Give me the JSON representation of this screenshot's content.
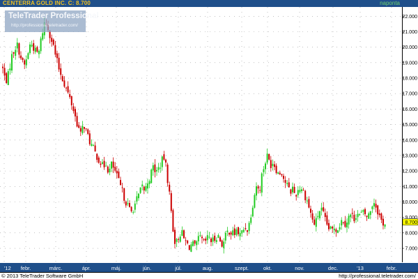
{
  "header": {
    "symbol": "CENTERRA GOLD INC.",
    "close_text": "C: 8.700",
    "period": "naponta"
  },
  "logo": {
    "title": "TeleTrader Professional",
    "url": "http://professional.teletrader.com/"
  },
  "footer": {
    "copyright": "© 2013 TeleTrader Software GmbH",
    "url": "http://professional.teletrader.com/"
  },
  "colors": {
    "up": "#22cc22",
    "down": "#cc0000",
    "header_bg": "#1f4f8a",
    "symbol_text": "#f0c020",
    "last_price_marker": "#ffff00"
  },
  "chart_data": {
    "type": "candlestick",
    "y_ticks": [
      "7.000",
      "8.000",
      "9.000",
      "10.000",
      "11.000",
      "12.000",
      "13.000",
      "14.000",
      "15.000",
      "16.000",
      "17.000",
      "18.000",
      "19.000",
      "20.000",
      "21.000",
      "22.000"
    ],
    "ylim": [
      6.1,
      22.6
    ],
    "x_labels": [
      "'12",
      "febr.",
      "márc.",
      "ápr.",
      "máj.",
      "jún.",
      "júl.",
      "aug.",
      "szept.",
      "okt.",
      "nov.",
      "dec.",
      "'13",
      "febr."
    ],
    "last_price": 8.7,
    "last_price_label": "8.700",
    "grid": true,
    "daily_close_path": [
      [
        0,
        19.4
      ],
      [
        4,
        18.6
      ],
      [
        8,
        17.8
      ],
      [
        12,
        18.2
      ],
      [
        16,
        19.3
      ],
      [
        20,
        19.8
      ],
      [
        24,
        20.2
      ],
      [
        28,
        19.7
      ],
      [
        32,
        19.0
      ],
      [
        36,
        18.8
      ],
      [
        40,
        19.6
      ],
      [
        44,
        20.3
      ],
      [
        48,
        20.0
      ],
      [
        52,
        19.6
      ],
      [
        56,
        19.7
      ],
      [
        60,
        20.8
      ],
      [
        64,
        21.6
      ],
      [
        68,
        21.4
      ],
      [
        72,
        20.8
      ],
      [
        76,
        20.2
      ],
      [
        80,
        19.4
      ],
      [
        84,
        18.7
      ],
      [
        88,
        18.2
      ],
      [
        92,
        17.7
      ],
      [
        96,
        17.2
      ],
      [
        100,
        16.7
      ],
      [
        104,
        16.2
      ],
      [
        108,
        15.5
      ],
      [
        112,
        14.9
      ],
      [
        116,
        14.3
      ],
      [
        120,
        15.1
      ],
      [
        124,
        14.5
      ],
      [
        128,
        14.0
      ],
      [
        132,
        13.6
      ],
      [
        136,
        13.2
      ],
      [
        140,
        12.9
      ],
      [
        144,
        12.6
      ],
      [
        148,
        12.2
      ],
      [
        152,
        12.6
      ],
      [
        156,
        11.9
      ],
      [
        160,
        12.4
      ],
      [
        164,
        12.1
      ],
      [
        168,
        11.6
      ],
      [
        172,
        11.1
      ],
      [
        176,
        10.6
      ],
      [
        180,
        10.1
      ],
      [
        184,
        9.7
      ],
      [
        188,
        9.3
      ],
      [
        192,
        9.7
      ],
      [
        196,
        10.1
      ],
      [
        200,
        10.5
      ],
      [
        204,
        11.0
      ],
      [
        208,
        10.7
      ],
      [
        212,
        11.3
      ],
      [
        216,
        11.7
      ],
      [
        220,
        12.3
      ],
      [
        224,
        11.9
      ],
      [
        228,
        12.2
      ],
      [
        232,
        12.6
      ],
      [
        236,
        12.9
      ],
      [
        240,
        11.7
      ],
      [
        244,
        10.2
      ],
      [
        248,
        8.4
      ],
      [
        252,
        7.2
      ],
      [
        256,
        7.7
      ],
      [
        260,
        8.1
      ],
      [
        264,
        7.6
      ],
      [
        268,
        7.3
      ],
      [
        272,
        7.1
      ],
      [
        276,
        7.3
      ],
      [
        280,
        7.0
      ],
      [
        284,
        7.5
      ],
      [
        288,
        7.7
      ],
      [
        292,
        7.3
      ],
      [
        296,
        7.5
      ],
      [
        300,
        7.8
      ],
      [
        304,
        7.4
      ],
      [
        308,
        7.6
      ],
      [
        312,
        7.9
      ],
      [
        316,
        7.5
      ],
      [
        320,
        7.2
      ],
      [
        324,
        7.8
      ],
      [
        328,
        8.2
      ],
      [
        332,
        8.0
      ],
      [
        336,
        7.9
      ],
      [
        340,
        8.2
      ],
      [
        344,
        7.8
      ],
      [
        348,
        8.1
      ],
      [
        352,
        8.4
      ],
      [
        356,
        8.2
      ],
      [
        360,
        9.2
      ],
      [
        364,
        10.2
      ],
      [
        368,
        11.1
      ],
      [
        372,
        10.6
      ],
      [
        376,
        11.8
      ],
      [
        380,
        12.5
      ],
      [
        384,
        13.0
      ],
      [
        388,
        12.4
      ],
      [
        392,
        12.6
      ],
      [
        396,
        12.2
      ],
      [
        400,
        11.8
      ],
      [
        404,
        12.0
      ],
      [
        408,
        11.4
      ],
      [
        412,
        11.1
      ],
      [
        416,
        10.6
      ],
      [
        420,
        10.9
      ],
      [
        424,
        10.4
      ],
      [
        428,
        10.8
      ],
      [
        432,
        11.0
      ],
      [
        436,
        10.6
      ],
      [
        440,
        10.2
      ],
      [
        444,
        9.6
      ],
      [
        448,
        8.9
      ],
      [
        452,
        8.5
      ],
      [
        456,
        9.1
      ],
      [
        460,
        9.6
      ],
      [
        464,
        9.2
      ],
      [
        468,
        8.6
      ],
      [
        472,
        8.3
      ],
      [
        476,
        8.1
      ],
      [
        480,
        8.4
      ],
      [
        484,
        8.2
      ],
      [
        488,
        8.6
      ],
      [
        492,
        8.9
      ],
      [
        496,
        8.6
      ],
      [
        500,
        9.0
      ],
      [
        504,
        9.2
      ],
      [
        508,
        8.9
      ],
      [
        512,
        9.3
      ],
      [
        516,
        9.1
      ],
      [
        520,
        9.3
      ],
      [
        524,
        9.2
      ],
      [
        528,
        9.0
      ],
      [
        532,
        9.5
      ],
      [
        536,
        10.1
      ],
      [
        540,
        9.7
      ],
      [
        544,
        9.2
      ],
      [
        548,
        8.7
      ],
      [
        552,
        8.6
      ]
    ]
  }
}
